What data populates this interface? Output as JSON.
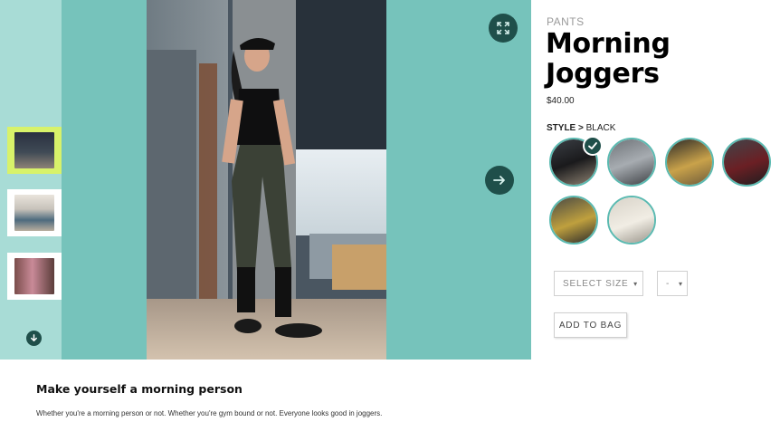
{
  "gallery": {
    "thumbnails": [
      {
        "label": "thumbnail-1",
        "active": true
      },
      {
        "label": "thumbnail-2",
        "active": false
      },
      {
        "label": "thumbnail-3",
        "active": false
      }
    ],
    "icons": {
      "scroll_down": "chevron-down-icon",
      "expand": "expand-icon",
      "next": "arrow-right-icon"
    },
    "accent_color": "#76c3bb",
    "strip_color": "#a8dcd6",
    "button_color": "#1f4f4a"
  },
  "product": {
    "category": "PANTS",
    "title": "Morning Joggers",
    "price": "$40.00",
    "style_label": "STYLE >",
    "style_value": "BLACK",
    "swatches": [
      {
        "name": "black",
        "selected": true
      },
      {
        "name": "grey",
        "selected": false
      },
      {
        "name": "mustard",
        "selected": false
      },
      {
        "name": "burgundy",
        "selected": false
      },
      {
        "name": "olive-mustard",
        "selected": false
      },
      {
        "name": "cream",
        "selected": false
      }
    ],
    "size_select": {
      "value": "SELECT SIZE"
    },
    "qty_select": {
      "value": "-"
    },
    "add_to_bag": "ADD TO BAG"
  },
  "description": {
    "heading": "Make yourself a morning person",
    "body": "Whether you're a morning person or not. Whether you're gym bound or not. Everyone looks good in joggers."
  }
}
